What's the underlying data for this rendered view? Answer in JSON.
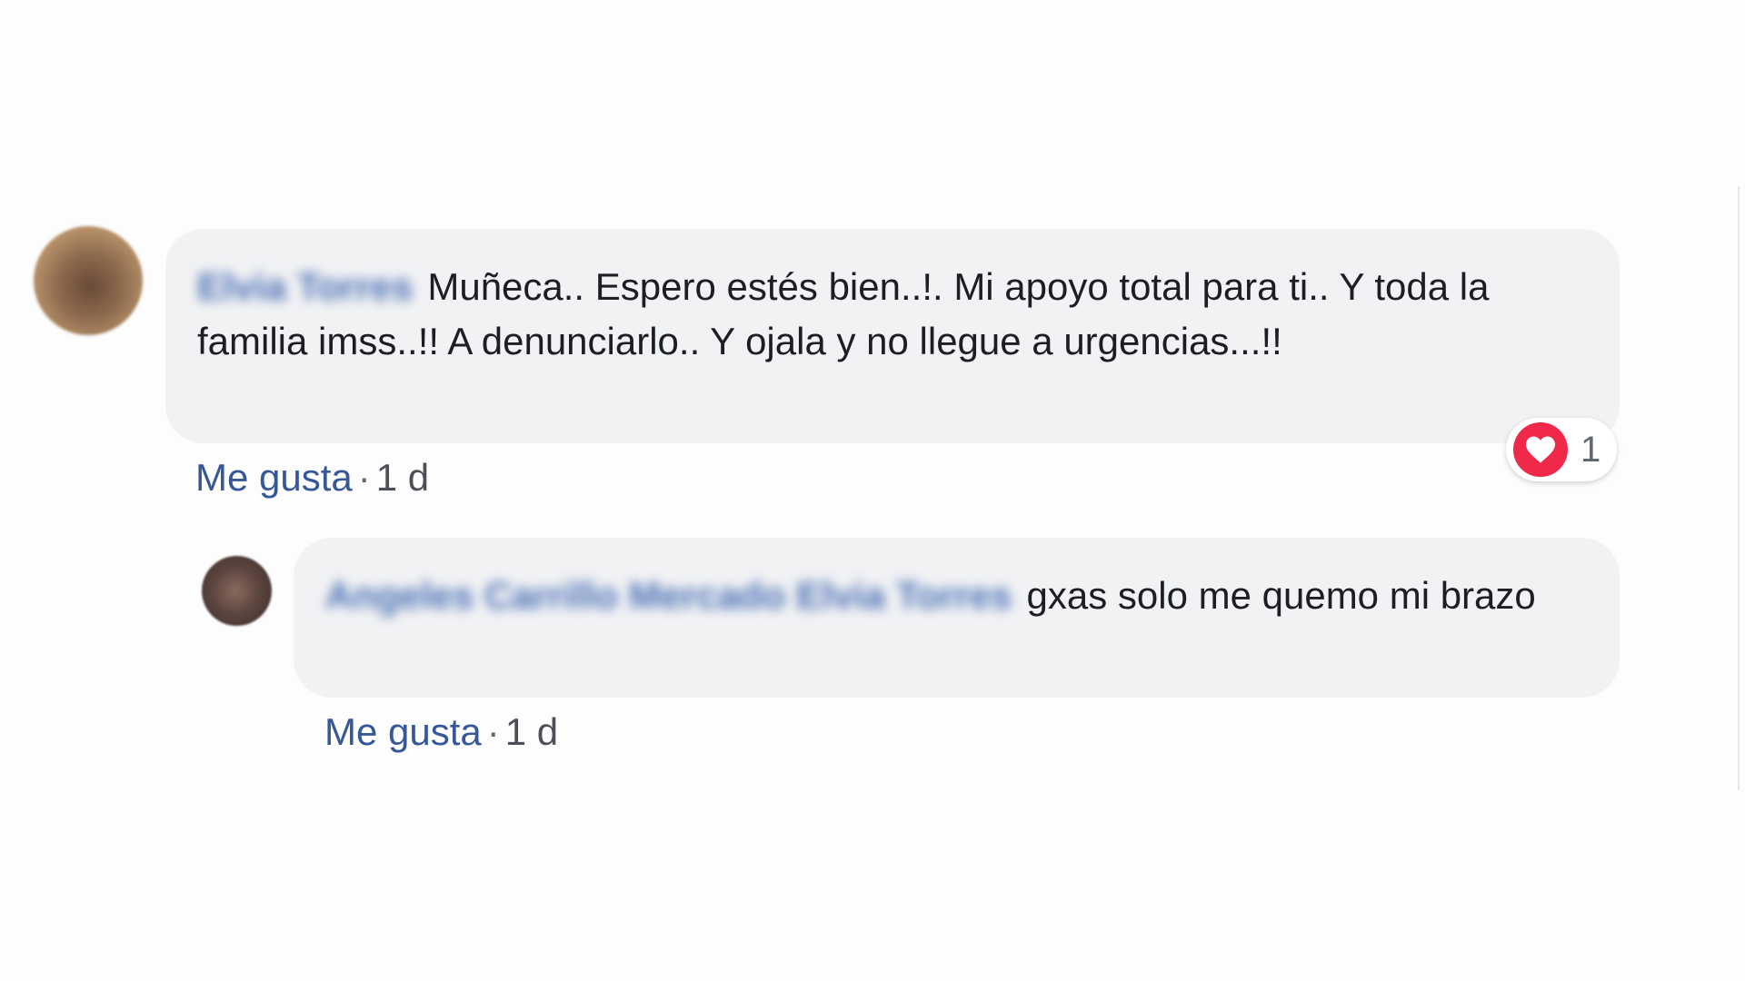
{
  "comments": [
    {
      "author": "Elvia Torres",
      "text": "Muñeca.. Espero estés bien..!. Mi apoyo total para ti.. Y toda la familia imss..!! A denunciarlo.. Y ojala y no llegue a urgencias...!!",
      "like_label": "Me gusta",
      "separator": "·",
      "time": "1 d",
      "reaction": {
        "icon": "heart-icon",
        "color": "#f0284a",
        "count": "1"
      }
    },
    {
      "author": "Angeles Carrillo Mercado Elvia Torres",
      "text": "gxas solo me quemo mi brazo",
      "like_label": "Me gusta",
      "separator": "·",
      "time": "1 d"
    }
  ]
}
